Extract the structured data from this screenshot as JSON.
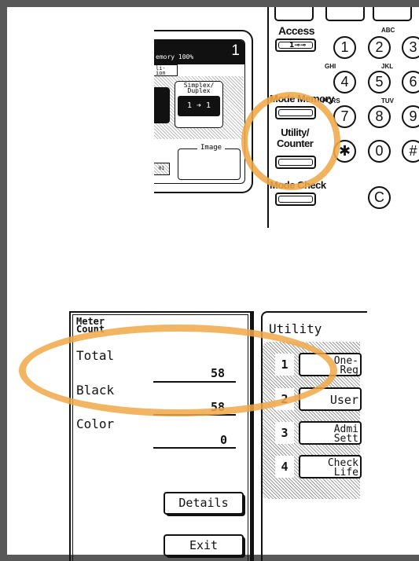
{
  "colors": {
    "highlight": "#F0A848",
    "frame": "#585858",
    "ink": "#111111"
  },
  "copier_screen": {
    "memory_label": "emory  100%",
    "copy_count": "1",
    "tab_label": "li-\nion",
    "simplex_label": "Simplex/\nDuplex",
    "simplex_value": "1 ➔ 1",
    "image_label": "Image",
    "small_btn": "01"
  },
  "keypad": {
    "access_label": "Access",
    "mode_memory_label": "Mode Memory",
    "utility_counter_label": "Utility/\nCounter",
    "mode_check_label": "Mode Check",
    "keys": [
      "1",
      "2",
      "3",
      "4",
      "5",
      "6",
      "7",
      "8",
      "9",
      "✱",
      "0",
      "#",
      "C"
    ],
    "letters": {
      "abc": "ABC",
      "ghi": "GHI",
      "jkl": "JKL",
      "pqrs": "PQRS",
      "tuv": "TUV"
    }
  },
  "meter_count": {
    "title": "Meter\nCount",
    "total_label": "Total",
    "total_value": "58",
    "black_label": "Black",
    "black_value": "58",
    "color_label": "Color",
    "color_value": "0",
    "details_button": "Details",
    "exit_button": "Exit"
  },
  "utility_menu": {
    "title": "Utility",
    "items": [
      {
        "number": "1",
        "label": "One-\nReg"
      },
      {
        "number": "2",
        "label": "User"
      },
      {
        "number": "3",
        "label": "Admi\nSett"
      },
      {
        "number": "4",
        "label": "Check\nLife"
      }
    ]
  }
}
